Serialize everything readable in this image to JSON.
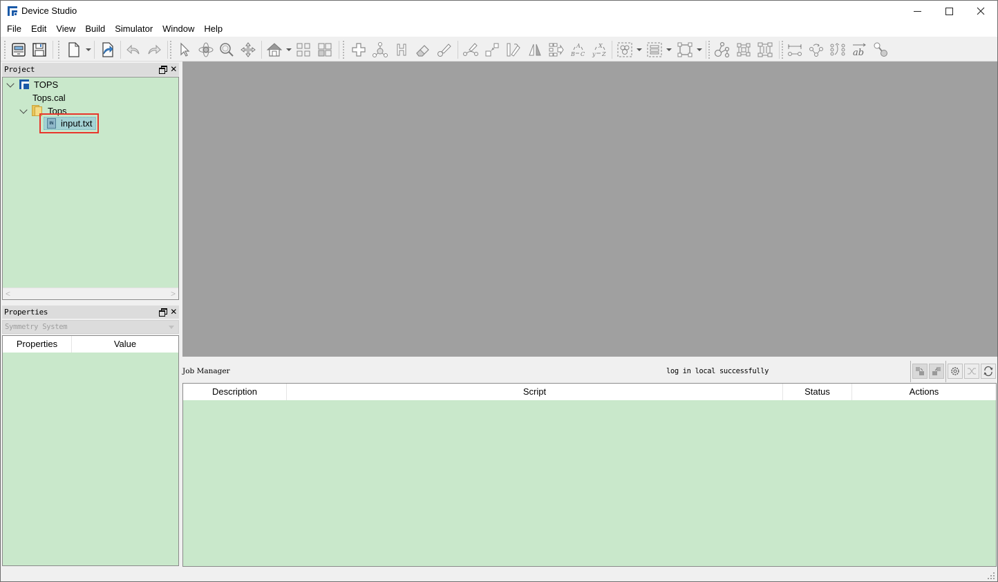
{
  "window": {
    "title": "Device Studio",
    "controls": [
      "minimize",
      "maximize",
      "close"
    ]
  },
  "menu": [
    "File",
    "Edit",
    "View",
    "Build",
    "Simulator",
    "Window",
    "Help"
  ],
  "toolbar": {
    "icons": [
      "open-project-icon",
      "save-icon",
      "new-file-icon",
      "export-icon",
      "undo-icon",
      "redo-icon",
      "select-pointer-icon",
      "rotate-icon",
      "zoom-icon",
      "pan-icon",
      "home-view-icon",
      "fit-view-icon",
      "grid-view-icon",
      "add-atom-icon",
      "add-bond-icon",
      "hydrogen-icon",
      "eraser-icon",
      "measure-icon",
      "edit-bond-icon",
      "scale-icon",
      "slice-icon",
      "mirror-icon",
      "transform-icon",
      "abc-cycle-icon",
      "xyz-cycle-icon",
      "select-group-icon",
      "align-icon",
      "bounding-box-icon",
      "molecule-icon",
      "supercell-icon",
      "lattice-icon",
      "distance-icon",
      "rotate-bond-icon",
      "swap-atoms-icon",
      "vector-ab-icon",
      "link-icon"
    ]
  },
  "project_panel": {
    "title": "Project",
    "tree": [
      {
        "label": "TOPS",
        "type": "project",
        "expanded": true
      },
      {
        "label": "Tops.cal",
        "type": "file"
      },
      {
        "label": "Tops",
        "type": "folder",
        "expanded": true
      },
      {
        "label": "input.txt",
        "type": "input-file",
        "selected": true
      }
    ]
  },
  "properties_panel": {
    "title": "Properties",
    "combo_value": "Symmetry System",
    "columns": [
      "Properties",
      "Value"
    ]
  },
  "job_manager": {
    "title": "Job Manager",
    "status_text": "log in local successfully",
    "columns": [
      "Description",
      "Script",
      "Status",
      "Actions"
    ]
  },
  "scroll": {
    "left": "<",
    "right": ">"
  }
}
